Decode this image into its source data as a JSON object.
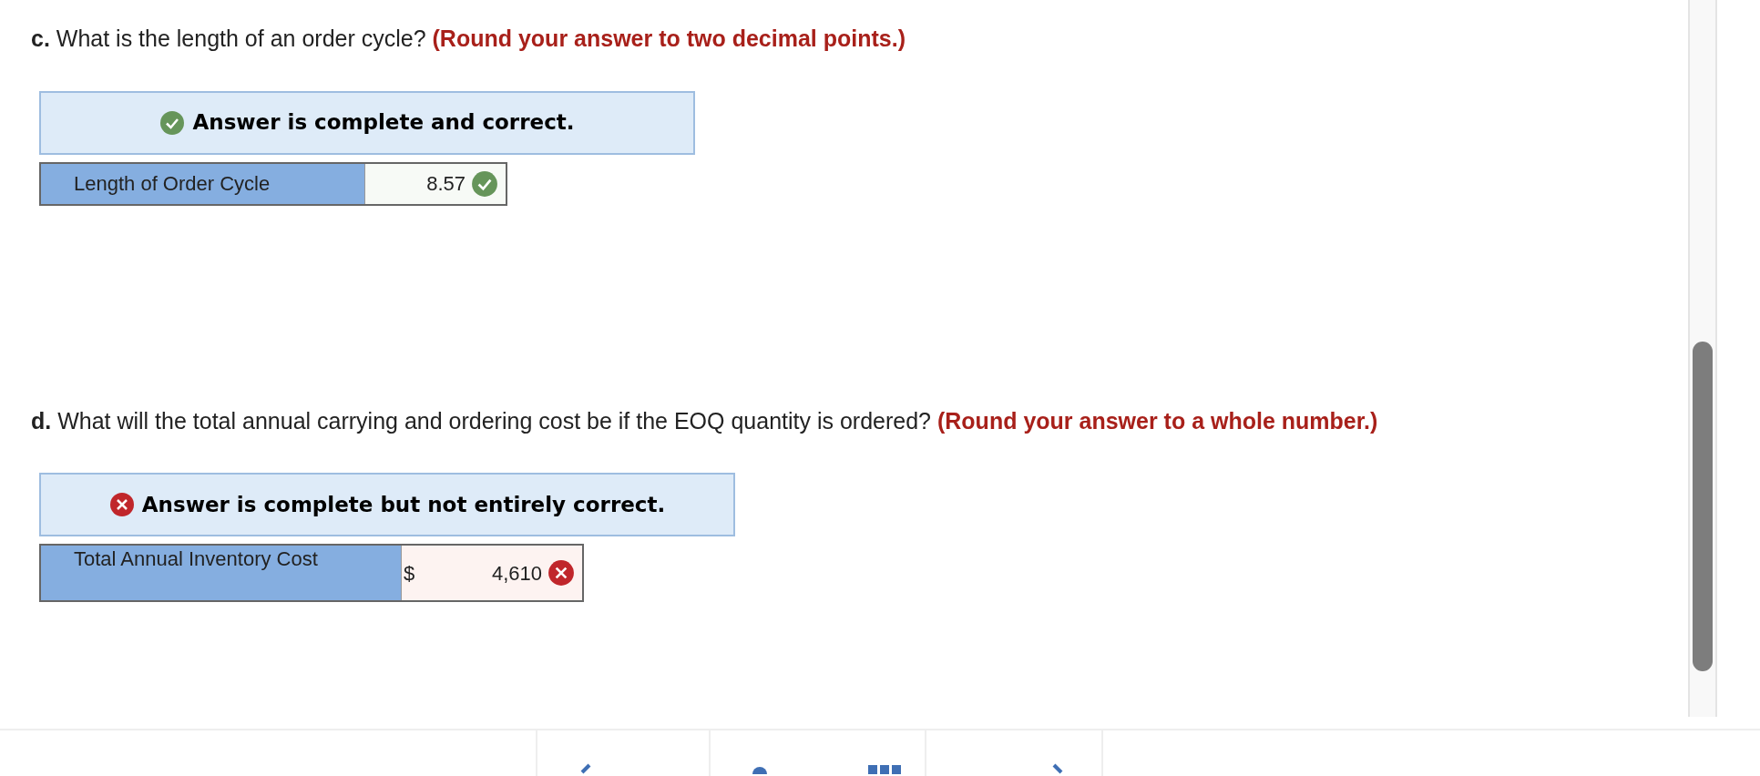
{
  "questions": [
    {
      "label": "c.",
      "text": "What is the length of an order cycle?",
      "instruction": "(Round your answer to two decimal points.)",
      "result": {
        "kind": "correct",
        "message": "Answer is complete and correct."
      },
      "answer": {
        "label": "Length of Order Cycle",
        "value": "8.57",
        "correct": true
      }
    },
    {
      "label": "d.",
      "text": "What will the total annual carrying and ordering cost be if the EOQ quantity is ordered?",
      "instruction": "(Round your answer to a whole number.)",
      "result": {
        "kind": "partial",
        "message": "Answer is complete but not entirely correct."
      },
      "answer": {
        "label": "Total Annual Inventory Cost",
        "prefix": "$",
        "value": "4,610",
        "correct": false
      }
    }
  ]
}
